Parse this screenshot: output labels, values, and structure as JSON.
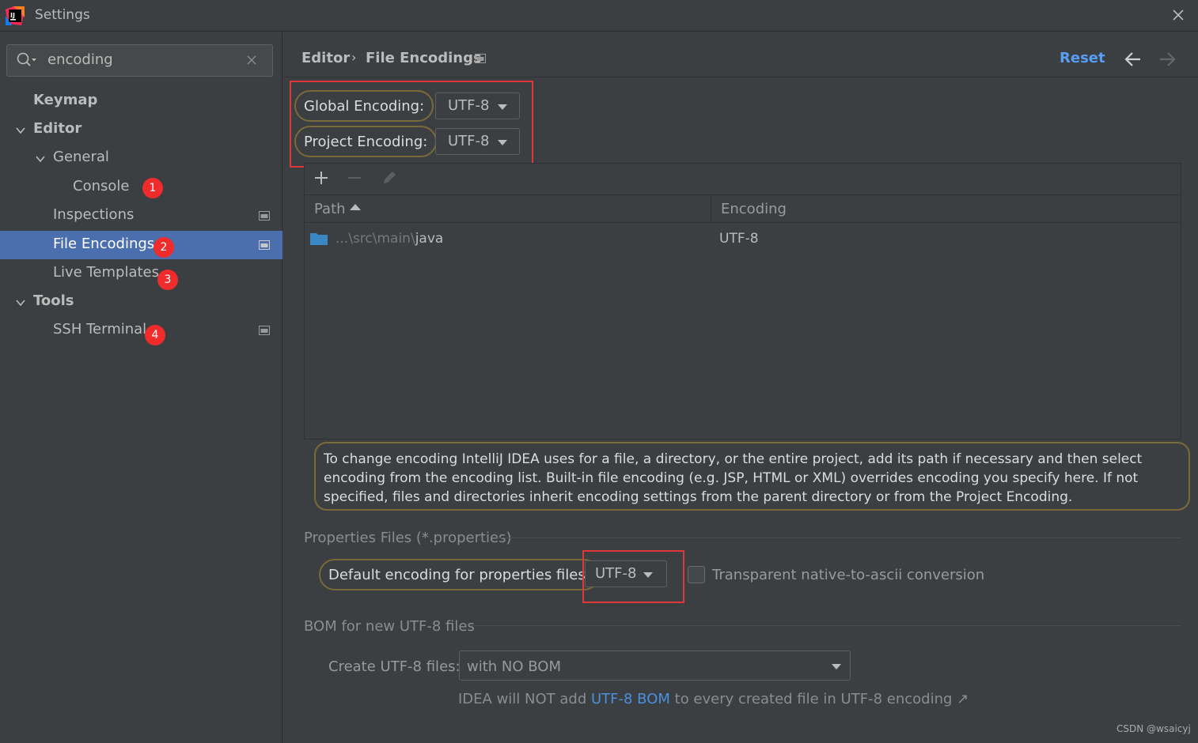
{
  "window": {
    "title": "Settings"
  },
  "search": {
    "value": "encoding"
  },
  "sidebar": {
    "items": [
      {
        "label": "Keymap"
      },
      {
        "label": "Editor"
      },
      {
        "label": "General"
      },
      {
        "label": "Console",
        "badge": "1"
      },
      {
        "label": "Inspections"
      },
      {
        "label": "File Encodings",
        "badge": "2"
      },
      {
        "label": "Live Templates",
        "badge": "3"
      },
      {
        "label": "Tools"
      },
      {
        "label": "SSH Terminal",
        "badge": "4"
      }
    ]
  },
  "header": {
    "breadcrumb_parent": "Editor",
    "breadcrumb_sep": "›",
    "breadcrumb_current": "File Encodings",
    "reset_label": "Reset"
  },
  "encodings": {
    "global_label": "Global Encoding:",
    "global_value": "UTF-8",
    "project_label": "Project Encoding:",
    "project_value": "UTF-8"
  },
  "table": {
    "columns": [
      "Path",
      "Encoding"
    ],
    "rows": [
      {
        "path_prefix": "...\\src\\main\\",
        "path_leaf": "java",
        "encoding": "UTF-8"
      }
    ]
  },
  "info_text": "To change encoding IntelliJ IDEA uses for a file, a directory, or the entire project, add its path if necessary and then select encoding from the encoding list. Built-in file encoding (e.g. JSP, HTML or XML) overrides encoding you specify here. If not specified, files and directories inherit encoding settings from the parent directory or from the Project Encoding.",
  "properties": {
    "section_title": "Properties Files (*.properties)",
    "default_label": "Default encoding for properties files:",
    "default_value": "UTF-8",
    "transparent_label": "Transparent native-to-ascii conversion",
    "transparent_checked": false
  },
  "bom": {
    "section_title": "BOM for new UTF-8 files",
    "create_label": "Create UTF-8 files:",
    "create_value": "with NO BOM",
    "note_prefix": "IDEA will NOT add ",
    "note_link": "UTF-8 BOM",
    "note_suffix": " to every created file in UTF-8 encoding ↗"
  },
  "watermark": "CSDN @wsaicyj",
  "colors": {
    "selection": "#4b6eaf",
    "link": "#589df6",
    "annotation_red": "#e0383a",
    "badge_red": "#f02b2b"
  }
}
